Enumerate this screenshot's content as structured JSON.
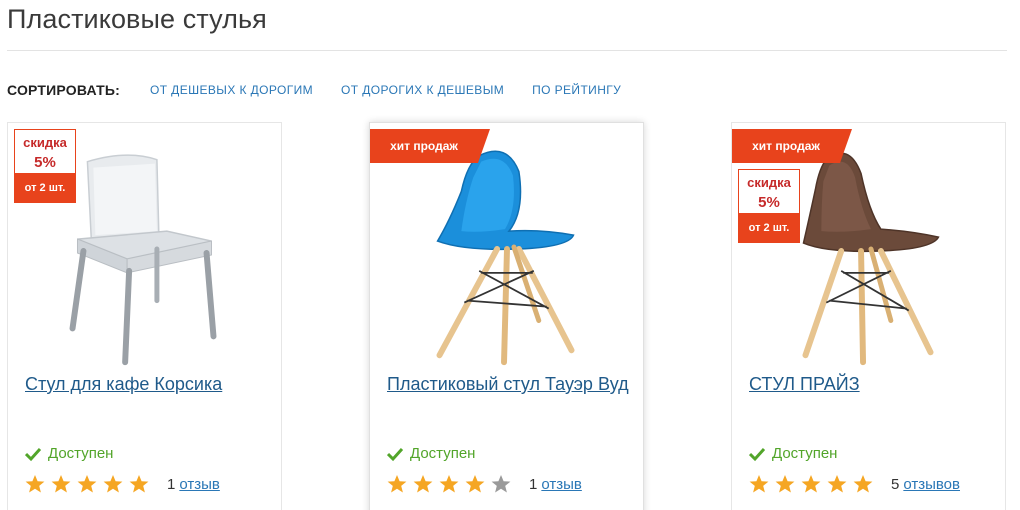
{
  "page": {
    "title": "Пластиковые стулья"
  },
  "sort": {
    "label": "СОРТИРОВАТЬ:",
    "options": [
      "от дешевых к дорогим",
      "от дорогих к дешевым",
      "по рейтингу"
    ]
  },
  "colors": {
    "accent_link": "#2a77b6",
    "badge_orange": "#e8431c",
    "available_green": "#52a52a",
    "star_gold": "#f5a623"
  },
  "products": [
    {
      "title": "Стул для кафе Корсика",
      "availability": "Доступен",
      "rating": 5,
      "review_count": "1",
      "review_word": "отзыв",
      "badges": {
        "hit": "",
        "discount_word": "скидка",
        "discount_value": "5%",
        "discount_condition": "от 2 шт."
      },
      "image": "white plastic chair with grey metal legs"
    },
    {
      "title": "Пластиковый стул Тауэр Вуд",
      "availability": "Доступен",
      "rating": 4,
      "review_count": "1",
      "review_word": "отзыв",
      "badges": {
        "hit": "хит продаж"
      },
      "image": "blue plastic chair with wooden legs"
    },
    {
      "title": "СТУЛ ПРАЙЗ",
      "availability": "Доступен",
      "rating": 5,
      "review_count": "5",
      "review_word": "отзывов",
      "badges": {
        "hit": "хит продаж",
        "discount_word": "скидка",
        "discount_value": "5%",
        "discount_condition": "от 2 шт."
      },
      "image": "brown plastic chair with wooden legs"
    }
  ]
}
